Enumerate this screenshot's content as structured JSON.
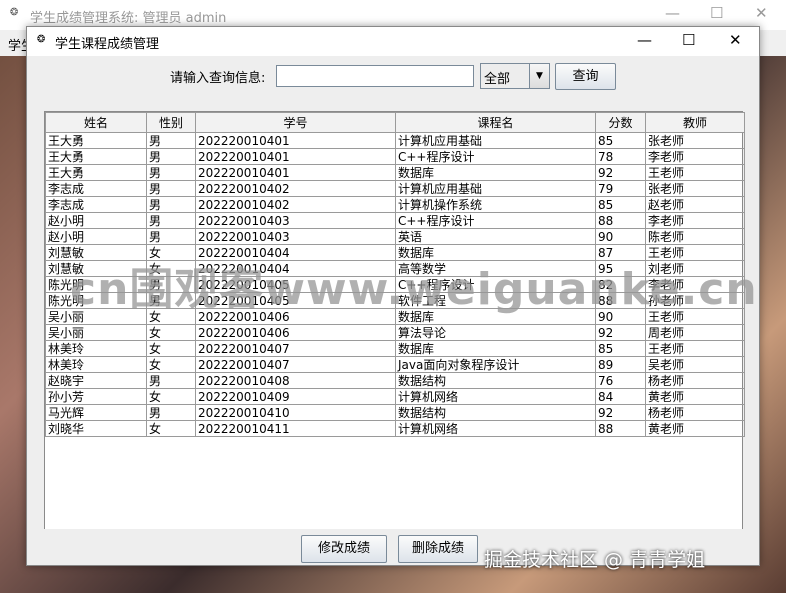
{
  "outer_window": {
    "title": "学生成绩管理系统: 管理员 admin",
    "menu_partial": "学生"
  },
  "dialog": {
    "title": "学生课程成绩管理",
    "minimize": "—",
    "maximize": "☐",
    "close": "✕"
  },
  "query": {
    "label": "请输入查询信息:",
    "value": "",
    "select_value": "全部",
    "button": "查询"
  },
  "table": {
    "headers": [
      "姓名",
      "性别",
      "学号",
      "课程名",
      "分数",
      "教师"
    ],
    "rows": [
      [
        "王大勇",
        "男",
        "202220010401",
        "计算机应用基础",
        "85",
        "张老师"
      ],
      [
        "王大勇",
        "男",
        "202220010401",
        "C++程序设计",
        "78",
        "李老师"
      ],
      [
        "王大勇",
        "男",
        "202220010401",
        "数据库",
        "92",
        "王老师"
      ],
      [
        "李志成",
        "男",
        "202220010402",
        "计算机应用基础",
        "79",
        "张老师"
      ],
      [
        "李志成",
        "男",
        "202220010402",
        "计算机操作系统",
        "85",
        "赵老师"
      ],
      [
        "赵小明",
        "男",
        "202220010403",
        "C++程序设计",
        "88",
        "李老师"
      ],
      [
        "赵小明",
        "男",
        "202220010403",
        "英语",
        "90",
        "陈老师"
      ],
      [
        "刘慧敏",
        "女",
        "202220010404",
        "数据库",
        "87",
        "王老师"
      ],
      [
        "刘慧敏",
        "女",
        "202220010404",
        "高等数学",
        "95",
        "刘老师"
      ],
      [
        "陈光明",
        "男",
        "202220010405",
        "C++程序设计",
        "82",
        "李老师"
      ],
      [
        "陈光明",
        "男",
        "202220010405",
        "软件工程",
        "88",
        "孙老师"
      ],
      [
        "吴小丽",
        "女",
        "202220010406",
        "数据库",
        "90",
        "王老师"
      ],
      [
        "吴小丽",
        "女",
        "202220010406",
        "算法导论",
        "92",
        "周老师"
      ],
      [
        "林美玲",
        "女",
        "202220010407",
        "数据库",
        "85",
        "王老师"
      ],
      [
        "林美玲",
        "女",
        "202220010407",
        "Java面向对象程序设计",
        "89",
        "吴老师"
      ],
      [
        "赵晓宇",
        "男",
        "202220010408",
        "数据结构",
        "76",
        "杨老师"
      ],
      [
        "孙小芳",
        "女",
        "202220010409",
        "计算机网络",
        "84",
        "黄老师"
      ],
      [
        "马光辉",
        "男",
        "202220010410",
        "数据结构",
        "92",
        "杨老师"
      ],
      [
        "刘晓华",
        "女",
        "202220010411",
        "计算机网络",
        "88",
        "黄老师"
      ]
    ]
  },
  "actions": {
    "edit": "修改成绩",
    "delete": "删除成绩"
  },
  "watermarks": {
    "center": "cn围观客www.weiguanke.cn",
    "bottom": "掘金技术社区 @ 青青学姐"
  }
}
